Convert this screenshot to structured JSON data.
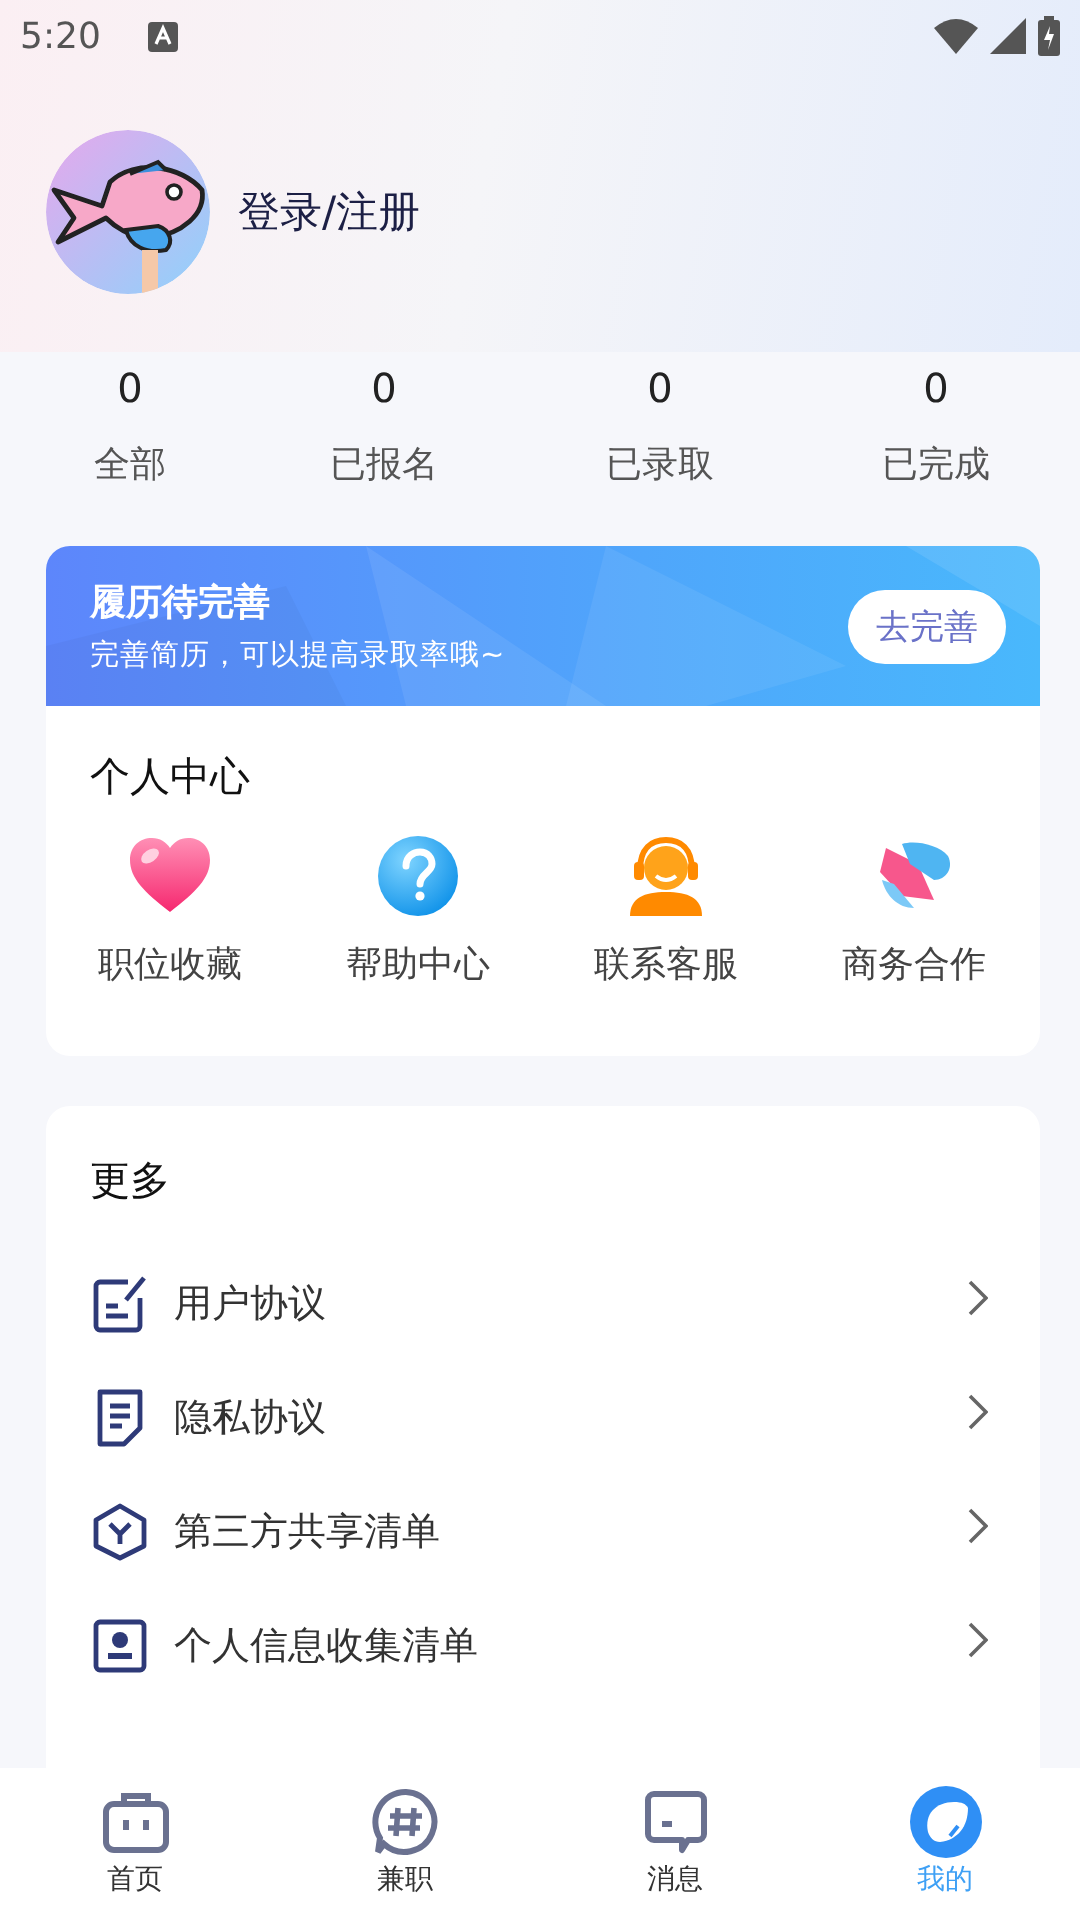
{
  "status_bar": {
    "time": "5:20"
  },
  "profile": {
    "login_label": "登录/注册"
  },
  "stats": [
    {
      "value": "0",
      "label": "全部"
    },
    {
      "value": "0",
      "label": "已报名"
    },
    {
      "value": "0",
      "label": "已录取"
    },
    {
      "value": "0",
      "label": "已完成"
    }
  ],
  "resume_banner": {
    "title": "履历待完善",
    "subtitle": "完善简历，可以提高录取率哦~",
    "button": "去完善"
  },
  "personal_center": {
    "title": "个人中心",
    "items": [
      {
        "kind": "heart",
        "label": "职位收藏"
      },
      {
        "kind": "help",
        "label": "帮助中心"
      },
      {
        "kind": "service",
        "label": "联系客服"
      },
      {
        "kind": "handshake",
        "label": "商务合作"
      }
    ]
  },
  "more": {
    "title": "更多",
    "items": [
      {
        "kind": "edit",
        "label": "用户协议"
      },
      {
        "kind": "doc",
        "label": "隐私协议"
      },
      {
        "kind": "hexagon",
        "label": "第三方共享清单"
      },
      {
        "kind": "person",
        "label": "个人信息收集清单"
      }
    ]
  },
  "bottom_nav": [
    {
      "kind": "home",
      "label": "首页",
      "selected": false
    },
    {
      "kind": "hash",
      "label": "兼职",
      "selected": false
    },
    {
      "kind": "message",
      "label": "消息",
      "selected": false
    },
    {
      "kind": "mine",
      "label": "我的",
      "selected": true
    }
  ]
}
